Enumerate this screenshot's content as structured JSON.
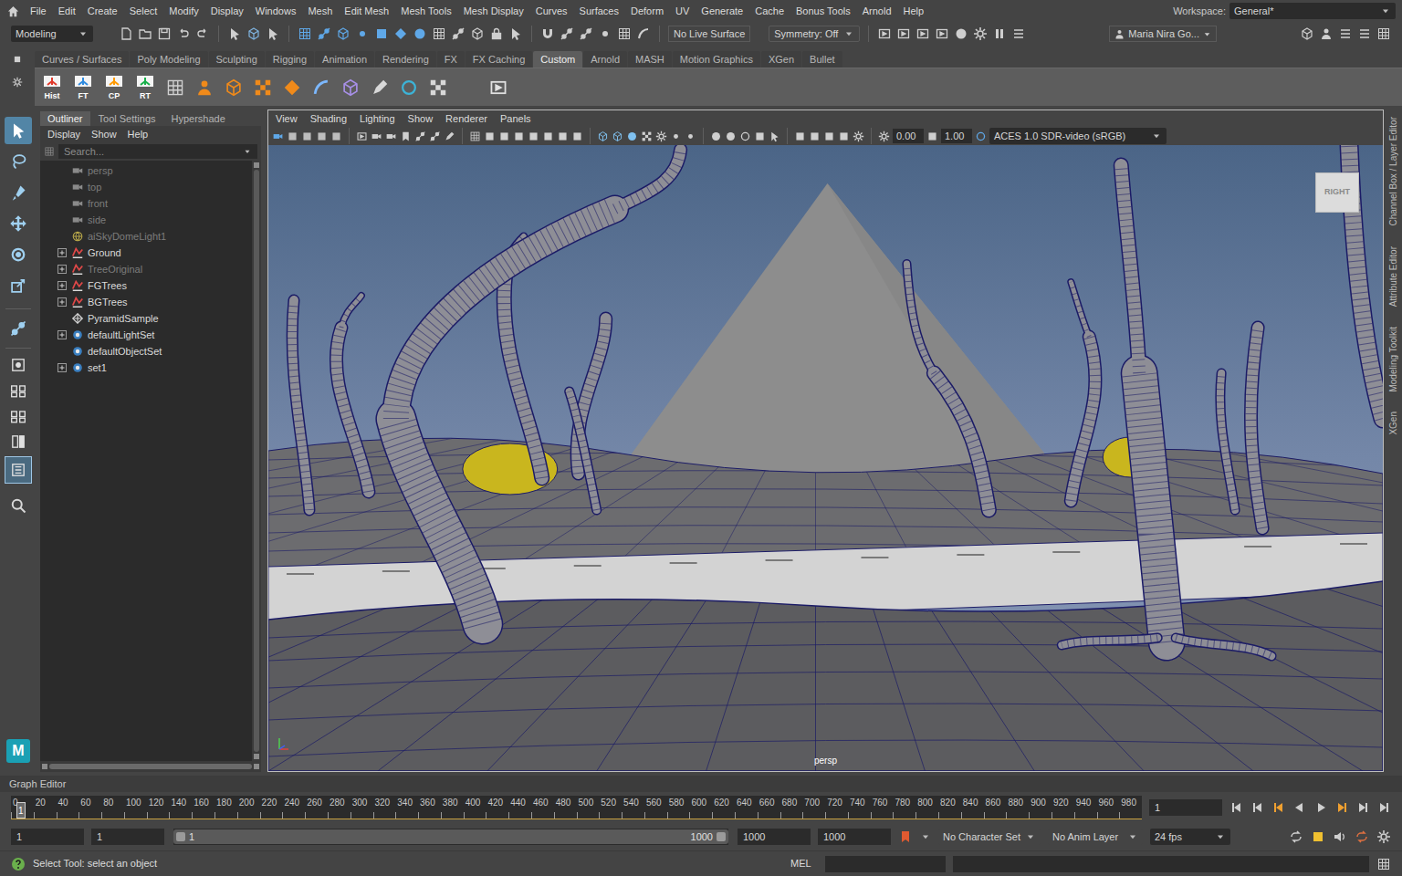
{
  "menu_bar": {
    "items": [
      "File",
      "Edit",
      "Create",
      "Select",
      "Modify",
      "Display",
      "Windows",
      "Mesh",
      "Edit Mesh",
      "Mesh Tools",
      "Mesh Display",
      "Curves",
      "Surfaces",
      "Deform",
      "UV",
      "Generate",
      "Cache",
      "Bonus Tools",
      "Arnold",
      "Help"
    ],
    "workspace_label": "Workspace:",
    "workspace": "General*"
  },
  "status_line": {
    "mode": "Modeling",
    "live_surface": "No Live Surface",
    "symmetry": "Symmetry: Off",
    "user": "Maria Nira Go..."
  },
  "shelf": {
    "tabs": [
      {
        "label": "Curves / Surfaces",
        "selected": false
      },
      {
        "label": "Poly Modeling",
        "selected": false
      },
      {
        "label": "Sculpting",
        "selected": false
      },
      {
        "label": "Rigging",
        "selected": false
      },
      {
        "label": "Animation",
        "selected": false
      },
      {
        "label": "Rendering",
        "selected": false
      },
      {
        "label": "FX",
        "selected": false
      },
      {
        "label": "FX Caching",
        "selected": false
      },
      {
        "label": "Custom",
        "selected": true
      },
      {
        "label": "Arnold",
        "selected": false
      },
      {
        "label": "MASH",
        "selected": false
      },
      {
        "label": "Motion Graphics",
        "selected": false
      },
      {
        "label": "XGen",
        "selected": false
      },
      {
        "label": "Bullet",
        "selected": false
      }
    ],
    "buttons": [
      "Hist",
      "FT",
      "CP",
      "RT"
    ]
  },
  "toolbox": {
    "tools": [
      {
        "selected": true
      },
      {
        "selected": false
      },
      {
        "selected": false
      },
      {
        "selected": false
      },
      {
        "selected": false
      },
      {
        "selected": false
      }
    ],
    "layouts": [
      {
        "selected": false
      },
      {
        "selected": false
      },
      {
        "selected": false
      },
      {
        "selected": false
      },
      {
        "selected": true
      }
    ],
    "logo": "M"
  },
  "outliner": {
    "tabs": [
      {
        "label": "Outliner",
        "selected": true
      },
      {
        "label": "Tool Settings",
        "selected": false
      },
      {
        "label": "Hypershade",
        "selected": false
      }
    ],
    "menu": [
      "Display",
      "Show",
      "Help"
    ],
    "search": {
      "placeholder": "Search..."
    },
    "items": [
      {
        "name": "persp",
        "kind": "camera",
        "dimmed": true,
        "expandable": false,
        "expanded": false
      },
      {
        "name": "top",
        "kind": "camera",
        "dimmed": true,
        "expandable": false,
        "expanded": false
      },
      {
        "name": "front",
        "kind": "camera",
        "dimmed": true,
        "expandable": false,
        "expanded": false
      },
      {
        "name": "side",
        "kind": "camera",
        "dimmed": true,
        "expandable": false,
        "expanded": false
      },
      {
        "name": "aiSkyDomeLight1",
        "kind": "light",
        "dimmed": true,
        "expandable": false,
        "expanded": false
      },
      {
        "name": "Ground",
        "kind": "group",
        "dimmed": false,
        "expandable": true,
        "expanded": false
      },
      {
        "name": "TreeOriginal",
        "kind": "group",
        "dimmed": true,
        "expandable": true,
        "expanded": false
      },
      {
        "name": "FGTrees",
        "kind": "group",
        "dimmed": false,
        "expandable": true,
        "expanded": false
      },
      {
        "name": "BGTrees",
        "kind": "group",
        "dimmed": false,
        "expandable": true,
        "expanded": false
      },
      {
        "name": "PyramidSample",
        "kind": "mesh",
        "dimmed": false,
        "expandable": false,
        "expanded": false
      },
      {
        "name": "defaultLightSet",
        "kind": "set",
        "dimmed": false,
        "expandable": true,
        "expanded": false
      },
      {
        "name": "defaultObjectSet",
        "kind": "set",
        "dimmed": false,
        "expandable": false,
        "expanded": false
      },
      {
        "name": "set1",
        "kind": "set",
        "dimmed": false,
        "expandable": true,
        "expanded": false
      }
    ]
  },
  "viewport": {
    "menu": [
      "View",
      "Shading",
      "Lighting",
      "Show",
      "Renderer",
      "Panels"
    ],
    "exposure": "0.00",
    "gamma": "1.00",
    "color_space": "ACES 1.0 SDR-video (sRGB)",
    "camera": "persp",
    "view_cube": "RIGHT"
  },
  "side_tabs": [
    "Channel Box / Layer Editor",
    "Attribute Editor",
    "Modeling Toolkit",
    "XGen"
  ],
  "graph_editor": {
    "label": "Graph Editor"
  },
  "time_slider": {
    "ticks": [
      "0",
      "20",
      "40",
      "60",
      "80",
      "100",
      "120",
      "140",
      "160",
      "180",
      "200",
      "220",
      "240",
      "260",
      "280",
      "300",
      "320",
      "340",
      "360",
      "380",
      "400",
      "420",
      "440",
      "460",
      "480",
      "500",
      "520",
      "540",
      "560",
      "580",
      "600",
      "620",
      "640",
      "660",
      "680",
      "700",
      "720",
      "740",
      "760",
      "780",
      "800",
      "820",
      "840",
      "860",
      "880",
      "900",
      "920",
      "940",
      "960",
      "980"
    ],
    "current_frame": "1",
    "frame_field": "1"
  },
  "range_slider": {
    "start": "1",
    "playback_start": "1",
    "range_start": "1",
    "range_end": "1000",
    "playback_end": "1000",
    "end": "1000",
    "level": 1
  },
  "character_set": "No Character Set",
  "anim_layer": "No Anim Layer",
  "fps": "24 fps",
  "command_line": {
    "help": "Select Tool: select an object",
    "language": "MEL"
  }
}
